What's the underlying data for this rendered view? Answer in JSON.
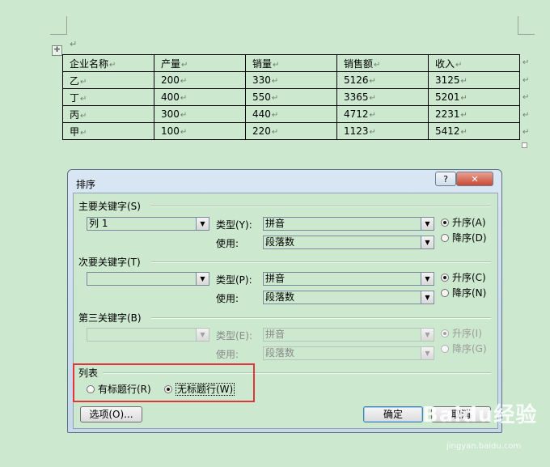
{
  "document": {
    "table": {
      "header": [
        "企业名称",
        "产量",
        "销量",
        "销售额",
        "收入"
      ],
      "rows": [
        [
          "乙",
          "200",
          "330",
          "5126",
          "3125"
        ],
        [
          "丁",
          "400",
          "550",
          "3365",
          "5201"
        ],
        [
          "丙",
          "300",
          "440",
          "4712",
          "2231"
        ],
        [
          "甲",
          "100",
          "220",
          "1123",
          "5412"
        ]
      ],
      "cell_mark": "↵"
    },
    "para_mark": "↵",
    "move_handle": "✛"
  },
  "dialog": {
    "title": "排序",
    "help_label": "?",
    "close_label": "✕",
    "primary": {
      "group_label": "主要关键字(S)",
      "field_value": "列 1",
      "type_label": "类型(Y):",
      "type_value": "拼音",
      "use_label": "使用:",
      "use_value": "段落数",
      "asc_label": "升序(A)",
      "desc_label": "降序(D)"
    },
    "secondary": {
      "group_label": "次要关键字(T)",
      "field_value": "",
      "type_label": "类型(P):",
      "type_value": "拼音",
      "use_label": "使用:",
      "use_value": "段落数",
      "asc_label": "升序(C)",
      "desc_label": "降序(N)"
    },
    "third": {
      "group_label": "第三关键字(B)",
      "field_value": "",
      "type_label": "类型(E):",
      "type_value": "拼音",
      "use_label": "使用:",
      "use_value": "段落数",
      "asc_label": "升序(I)",
      "desc_label": "降序(G)"
    },
    "list": {
      "group_label": "列表",
      "with_header_label": "有标题行(R)",
      "no_header_label": "无标题行(W)"
    },
    "options_label": "选项(O)...",
    "ok_label": "确定",
    "cancel_label": "取消"
  },
  "watermark": {
    "brand": "Baidu经验",
    "url": "jingyan.baidu.com"
  }
}
